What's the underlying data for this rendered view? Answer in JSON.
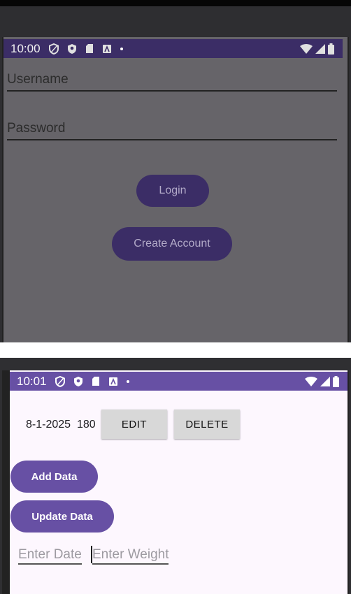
{
  "login_screen": {
    "status_time": "10:00",
    "username_placeholder": "Username",
    "password_placeholder": "Password",
    "login_label": "Login",
    "create_account_label": "Create Account"
  },
  "data_screen": {
    "status_time": "10:01",
    "record": {
      "date": "8-1-2025",
      "weight": "180",
      "edit_label": "EDIT",
      "delete_label": "DELETE"
    },
    "add_data_label": "Add Data",
    "update_data_label": "Update Data",
    "date_placeholder": "Enter Date",
    "weight_placeholder": "Enter Weight"
  },
  "icons": [
    "shield-outline-icon",
    "shield-filled-icon",
    "sd-card-icon",
    "app-store-icon",
    "notification-dot-icon",
    "wifi-icon",
    "cellular-signal-icon",
    "battery-icon"
  ],
  "colors": {
    "primary": "#6750a4",
    "primary_dimmed": "#3b2d66",
    "surface": "#fdf7fe",
    "dim_overlay": "#666469",
    "button_gray": "#d8d8d8"
  }
}
